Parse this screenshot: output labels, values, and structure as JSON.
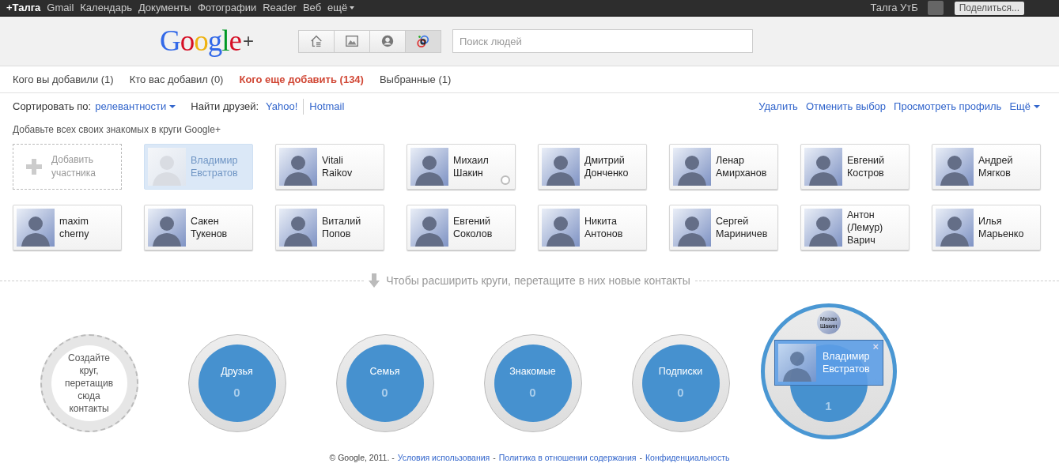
{
  "topbar": {
    "items": [
      {
        "label": "+Талга",
        "selected": true,
        "kind": "link"
      },
      {
        "label": "Gmail",
        "selected": false,
        "kind": "link"
      },
      {
        "label": "Календарь",
        "selected": false,
        "kind": "link"
      },
      {
        "label": "Документы",
        "selected": false,
        "kind": "link"
      },
      {
        "label": "Фотографии",
        "selected": false,
        "kind": "link"
      },
      {
        "label": "Reader",
        "selected": false,
        "kind": "link"
      },
      {
        "label": "Веб",
        "selected": false,
        "kind": "link"
      },
      {
        "label": "ещё",
        "selected": false,
        "kind": "menu"
      }
    ],
    "user": "Талга УтБ",
    "share_button": "Поделиться..."
  },
  "header": {
    "logo": "Google",
    "logo_plus": "+",
    "nav": [
      {
        "selected": false
      },
      {
        "selected": false
      },
      {
        "selected": false
      },
      {
        "selected": true
      }
    ],
    "search": {
      "placeholder": "Поиск людей"
    }
  },
  "tabs": [
    {
      "label": "Кого вы добавили (1)",
      "selected": false
    },
    {
      "label": "Кто вас добавил (0)",
      "selected": false
    },
    {
      "label": "Кого еще добавить (134)",
      "selected": true
    },
    {
      "label": "Выбранные (1)",
      "selected": false
    }
  ],
  "toolbar": {
    "sort_label": "Сортировать по:",
    "sort_value": "релевантности",
    "find_label": "Найти друзей:",
    "find_links": [
      "Yahoo!",
      "Hotmail"
    ],
    "actions": [
      "Удалить",
      "Отменить выбор",
      "Просмотреть профиль"
    ],
    "more": "Ещё"
  },
  "hint": "Добавьте всех своих знакомых в круги Google+",
  "add_card": {
    "label": "Добавить участника"
  },
  "people": [
    {
      "name": "Владимир Евстратов",
      "selected": true,
      "hovered": false
    },
    {
      "name": "Vitali Raikov",
      "selected": false,
      "hovered": false
    },
    {
      "name": "Михаил Шакин",
      "selected": false,
      "hovered": true
    },
    {
      "name": "Дмитрий Донченко",
      "selected": false,
      "hovered": false
    },
    {
      "name": "Ленар Амирханов",
      "selected": false,
      "hovered": false
    },
    {
      "name": "Евгений Костров",
      "selected": false,
      "hovered": false
    },
    {
      "name": "Андрей Мягков",
      "selected": false,
      "hovered": false
    },
    {
      "name": "maxim cherny",
      "selected": false,
      "hovered": false
    },
    {
      "name": "Сакен Тукенов",
      "selected": false,
      "hovered": false
    },
    {
      "name": "Виталий Попов",
      "selected": false,
      "hovered": false
    },
    {
      "name": "Евгений Соколов",
      "selected": false,
      "hovered": false
    },
    {
      "name": "Никита Антонов",
      "selected": false,
      "hovered": false
    },
    {
      "name": "Сергей Мариничев",
      "selected": false,
      "hovered": false
    },
    {
      "name": "Антон (Лемур) Варич",
      "selected": false,
      "hovered": false
    },
    {
      "name": "Илья Марьенко",
      "selected": false,
      "hovered": false
    }
  ],
  "drop_hint": "Чтобы расширить круги, перетащите в них новые контакты",
  "circles": [
    {
      "kind": "create",
      "label": "Создайте круг, перетащив сюда контакты"
    },
    {
      "kind": "circle",
      "name": "Друзья",
      "count": "0"
    },
    {
      "kind": "circle",
      "name": "Семья",
      "count": "0"
    },
    {
      "kind": "circle",
      "name": "Знакомые",
      "count": "0"
    },
    {
      "kind": "circle",
      "name": "Подписки",
      "count": "0"
    },
    {
      "kind": "active",
      "count": "1",
      "member": "Михаи Шакин"
    }
  ],
  "dragged_card": {
    "name": "Владимир Евстратов",
    "close": "×"
  },
  "footer": {
    "copyright": "© Google, 2011. -",
    "separator": "-",
    "links": [
      "Условия использования",
      "Политика в отношении содержания",
      "Конфиденциальность"
    ]
  }
}
